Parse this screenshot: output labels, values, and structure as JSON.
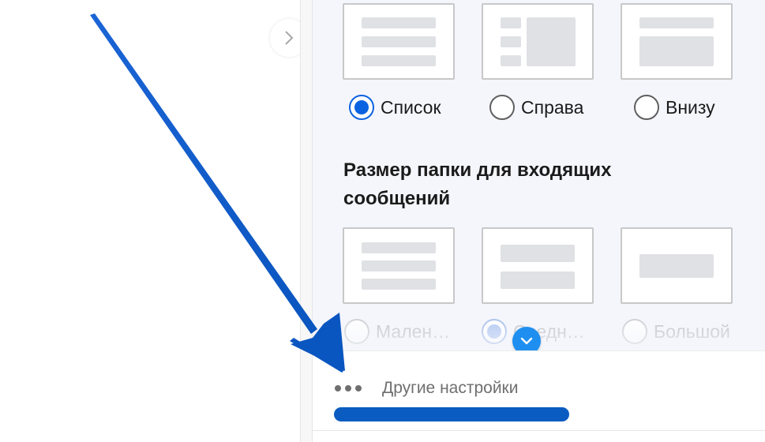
{
  "layout_options": {
    "options": [
      {
        "label": "Список",
        "checked": true
      },
      {
        "label": "Справа",
        "checked": false
      },
      {
        "label": "Внизу",
        "checked": false
      }
    ]
  },
  "folder_size": {
    "title": "Размер папки для входящих сообщений",
    "options": [
      {
        "label": "Мален…",
        "checked": false
      },
      {
        "label": "Средн…",
        "checked": true
      },
      {
        "label": "Большой",
        "checked": false
      }
    ]
  },
  "footer": {
    "other_settings_label": "Другие настройки"
  },
  "icons": {
    "collapse": "chevron-right-icon",
    "scroll": "chevron-down-icon",
    "more": "more-dots-icon"
  },
  "colors": {
    "accent": "#0b62e0",
    "annotation": "#0a5cc0",
    "scroll_button": "#1e8ff0"
  }
}
